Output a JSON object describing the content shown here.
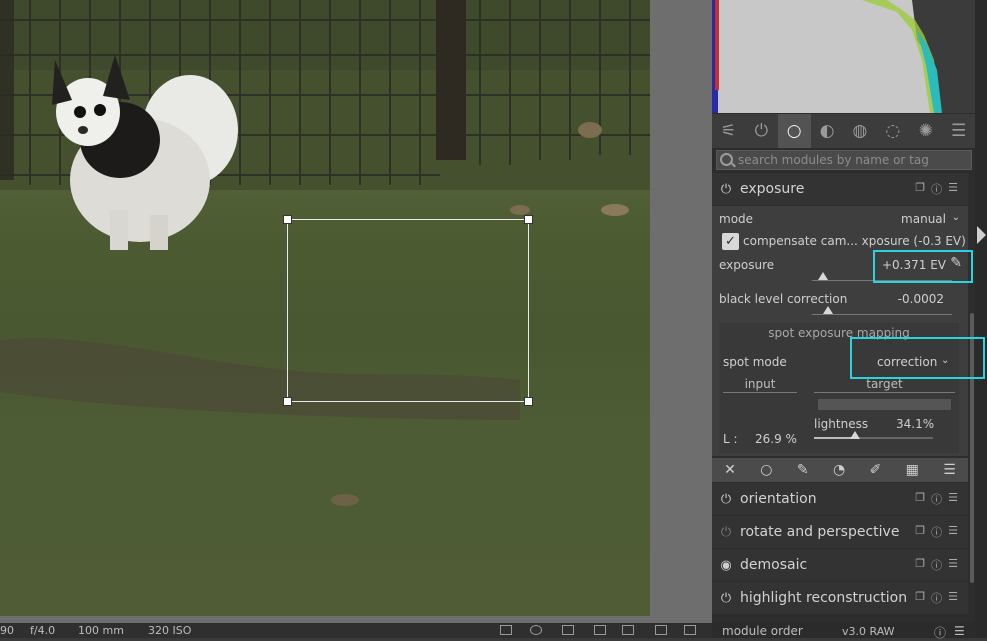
{
  "search": {
    "placeholder": "search modules by name or tag"
  },
  "module_group_tabs": [
    "quick-access-icon",
    "power-icon",
    "circle-icon",
    "shaded-circle-icon",
    "color-circle-icon",
    "correct-icon",
    "aperture-icon",
    "menu-icon"
  ],
  "exposure": {
    "title": "exposure",
    "mode_label": "mode",
    "mode_value": "manual",
    "compensate_label": "compensate cam... xposure (-0.3 EV)",
    "exposure_label": "exposure",
    "exposure_value": "+0.371 EV",
    "black_level_label": "black level correction",
    "black_level_value": "-0.0002",
    "spot": {
      "title": "spot exposure mapping",
      "mode_label": "spot mode",
      "mode_value": "correction",
      "input_label": "input",
      "target_label": "target",
      "l_label": "L :",
      "l_value": "26.9 %",
      "lightness_label": "lightness",
      "lightness_value": "34.1%",
      "lightness_fraction": 0.341
    }
  },
  "modules": [
    {
      "name": "orientation"
    },
    {
      "name": "rotate and perspective"
    },
    {
      "name": "demosaic"
    },
    {
      "name": "highlight reconstruction"
    }
  ],
  "module_order": {
    "label": "module order",
    "value": "v3.0 RAW"
  },
  "status_bar": {
    "left": "90",
    "aperture": "f/4.0",
    "focal": "100 mm",
    "iso": "320 ISO"
  },
  "colors": {
    "highlight": "#2ad4df",
    "panel": "#2d2d2d"
  }
}
